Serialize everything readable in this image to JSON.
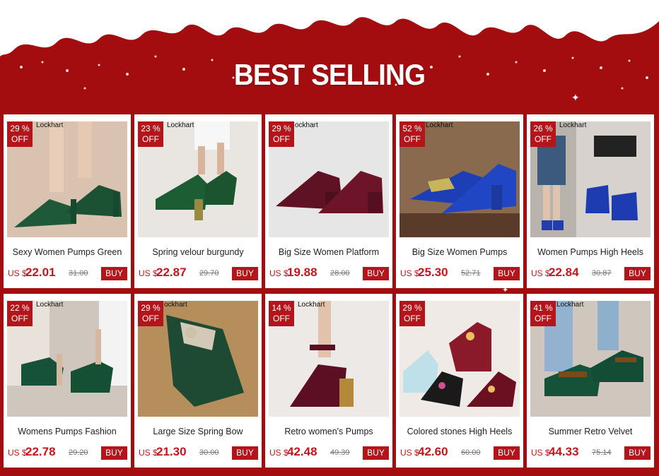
{
  "page": {
    "title": "BEST SELLING"
  },
  "products": [
    {
      "name": "Sexy Women Pumps Green",
      "discount": "29 %",
      "off": "OFF",
      "brand": "Lockhart",
      "currency": "US $",
      "price": "22.01",
      "old_price": "31.00",
      "buy": "BUY",
      "image": "green-satin-mary-jane-pump"
    },
    {
      "name": "Spring velour burgundy",
      "discount": "23 %",
      "off": "OFF",
      "brand": "Lockhart",
      "currency": "US $",
      "price": "22.87",
      "old_price": "29.70",
      "buy": "BUY",
      "image": "green-velvet-ankle-strap-pump"
    },
    {
      "name": "Big Size Women Platform",
      "discount": "29 %",
      "off": "OFF",
      "brand": "ockhart",
      "currency": "US $",
      "price": "19.88",
      "old_price": "28.00",
      "buy": "BUY",
      "image": "burgundy-velvet-platform-pump"
    },
    {
      "name": "Big Size Women Pumps",
      "discount": "52 %",
      "off": "OFF",
      "brand": "Lockhart",
      "currency": "US $",
      "price": "25.30",
      "old_price": "52.71",
      "buy": "BUY",
      "image": "blue-velvet-crystal-pump"
    },
    {
      "name": "Women Pumps High Heels",
      "discount": "26 %",
      "off": "OFF",
      "brand": "Lockhart",
      "currency": "US $",
      "price": "22.84",
      "old_price": "30.87",
      "buy": "BUY",
      "image": "blue-suede-bootie"
    },
    {
      "name": "Womens Pumps Fashion",
      "discount": "22 %",
      "off": "OFF",
      "brand": "Lockhart",
      "currency": "US $",
      "price": "22.78",
      "old_price": "29.20",
      "buy": "BUY",
      "image": "green-peep-toe-sandal"
    },
    {
      "name": "Large Size Spring Bow",
      "discount": "29 %",
      "off": "OFF",
      "brand": "ockhart",
      "currency": "US $",
      "price": "21.30",
      "old_price": "30.00",
      "buy": "BUY",
      "image": "green-velvet-bow-flat"
    },
    {
      "name": "Retro women's Pumps",
      "discount": "14 %",
      "off": "OFF",
      "brand": "Lockhart",
      "currency": "US $",
      "price": "42.48",
      "old_price": "49.39",
      "buy": "BUY",
      "image": "burgundy-jeweled-heel-pump"
    },
    {
      "name": "Colored stones High Heels",
      "discount": "29 %",
      "off": "OFF",
      "brand": "",
      "currency": "US $",
      "price": "42.60",
      "old_price": "60.00",
      "buy": "BUY",
      "image": "colored-stone-pumps"
    },
    {
      "name": "Summer Retro Velvet",
      "discount": "41 %",
      "off": "OFF",
      "brand": "Lockhart",
      "currency": "US $",
      "price": "44.33",
      "old_price": "75.14",
      "buy": "BUY",
      "image": "green-velvet-jewel-loafer"
    }
  ]
}
